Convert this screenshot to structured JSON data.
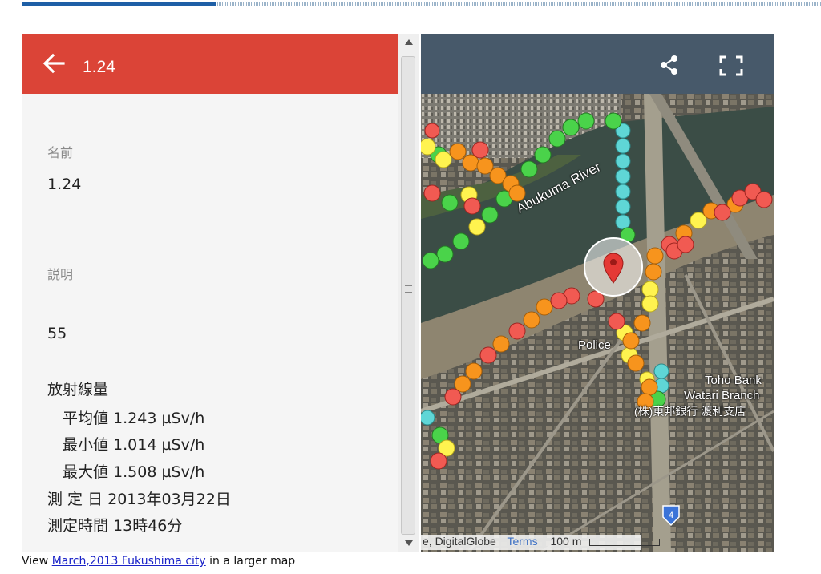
{
  "panel": {
    "title": "1.24",
    "name_label": "名前",
    "name_value": "1.24",
    "description_label": "説明",
    "description_value": "55",
    "radiation_heading": "放射線量",
    "average": "平均値 1.243 µSv/h",
    "minimum": "最小値 1.014 µSv/h",
    "maximum": "最大値 1.508 µSv/h",
    "measure_date": "測 定 日 2013年03月22日",
    "measure_time": "測定時間 13時46分"
  },
  "map": {
    "river_label": "Abukuma River",
    "police_label": "Police",
    "bank_label_1": "Toho Bank",
    "bank_label_2": "Watari Branch",
    "bank_label_3": "(株)東邦銀行 渡利支店",
    "route_badge": "4",
    "attribution_provider": "e, DigitalGlobe",
    "attribution_terms": "Terms",
    "scale_label": "100 m",
    "share_icon": "share-icon",
    "fullscreen_icon": "fullscreen-icon"
  },
  "footer": {
    "prefix": "View",
    "link_text": "March,2013 Fukushima city",
    "suffix": "in a larger map"
  },
  "colors": {
    "header_red": "#db4437",
    "map_header": "#47596a",
    "marker_red": "#f15a52",
    "marker_orange": "#f7941d",
    "marker_yellow": "#fff34f",
    "marker_green": "#4ad34a",
    "marker_cyan": "#5fd6d6"
  }
}
